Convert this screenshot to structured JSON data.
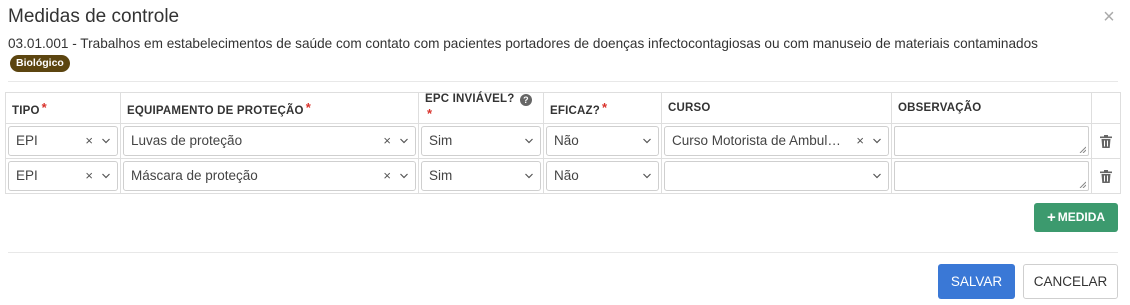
{
  "modal": {
    "title": "Medidas de controle",
    "close_symbol": "×",
    "description": "03.01.001 - Trabalhos em estabelecimentos de saúde com contato com pacientes portadores de doenças infectocontagiosas ou com manuseio de materiais contaminados",
    "badge": "Biológico",
    "badge_color": "#5c4510"
  },
  "table": {
    "headers": {
      "tipo": "TIPO",
      "equipamento": "EQUIPAMENTO DE PROTEÇÃO",
      "epc": "EPC INVIÁVEL?",
      "eficaz": "EFICAZ?",
      "curso": "CURSO",
      "observacao": "OBSERVAÇÃO"
    },
    "required_mark": "*",
    "help_icon_text": "?",
    "rows": [
      {
        "tipo": "EPI",
        "equipamento": "Luvas de proteção",
        "epc": "Sim",
        "eficaz": "Não",
        "curso": "Curso Motorista de Ambulância",
        "observacao": ""
      },
      {
        "tipo": "EPI",
        "equipamento": "Máscara de proteção",
        "epc": "Sim",
        "eficaz": "Não",
        "curso": "",
        "observacao": ""
      }
    ]
  },
  "actions": {
    "add_plus": "+",
    "add_label": "MEDIDA",
    "save_label": "SALVAR",
    "cancel_label": "CANCELAR"
  },
  "colors": {
    "save": "#3a78d6",
    "add": "#3c9a6e",
    "required": "#d9322b"
  },
  "icons": {
    "clear": "×",
    "dropdown": "chevron-down-icon",
    "delete": "trash-icon",
    "help": "question-circle-icon",
    "close": "close-icon"
  }
}
